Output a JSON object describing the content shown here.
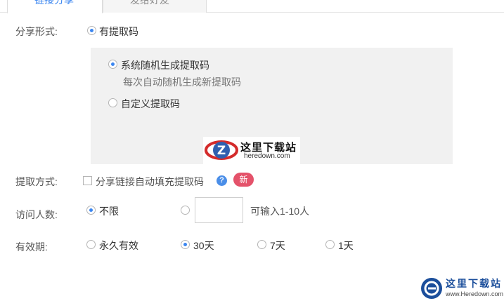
{
  "tabs": [
    {
      "label": "链接分享",
      "active": true
    },
    {
      "label": "发给好友",
      "active": false
    }
  ],
  "share_form": {
    "label": "分享形式:",
    "option": "有提取码",
    "sub_options": [
      {
        "label": "系统随机生成提取码",
        "hint": "每次自动随机生成新提取码",
        "checked": true
      },
      {
        "label": "自定义提取码",
        "checked": false
      }
    ]
  },
  "extract_method": {
    "label": "提取方式:",
    "checkbox_label": "分享链接自动填充提取码",
    "help_icon": "question-mark",
    "badge": "新"
  },
  "visitors": {
    "label": "访问人数:",
    "option_unlimited": "不限",
    "input_value": "",
    "hint": "可输入1-10人"
  },
  "validity": {
    "label": "有效期:",
    "options": [
      {
        "label": "永久有效",
        "checked": false
      },
      {
        "label": "30天",
        "checked": true
      },
      {
        "label": "7天",
        "checked": false
      },
      {
        "label": "1天",
        "checked": false
      }
    ]
  },
  "watermarks": {
    "center": {
      "name": "这里下载站",
      "url": "heredown.com"
    },
    "corner": {
      "name": "这里下载站",
      "url": "www.Heredown.com"
    }
  },
  "colors": {
    "accent": "#3b86f0",
    "badge": "#e4526a",
    "panel": "#f1f1f1"
  }
}
